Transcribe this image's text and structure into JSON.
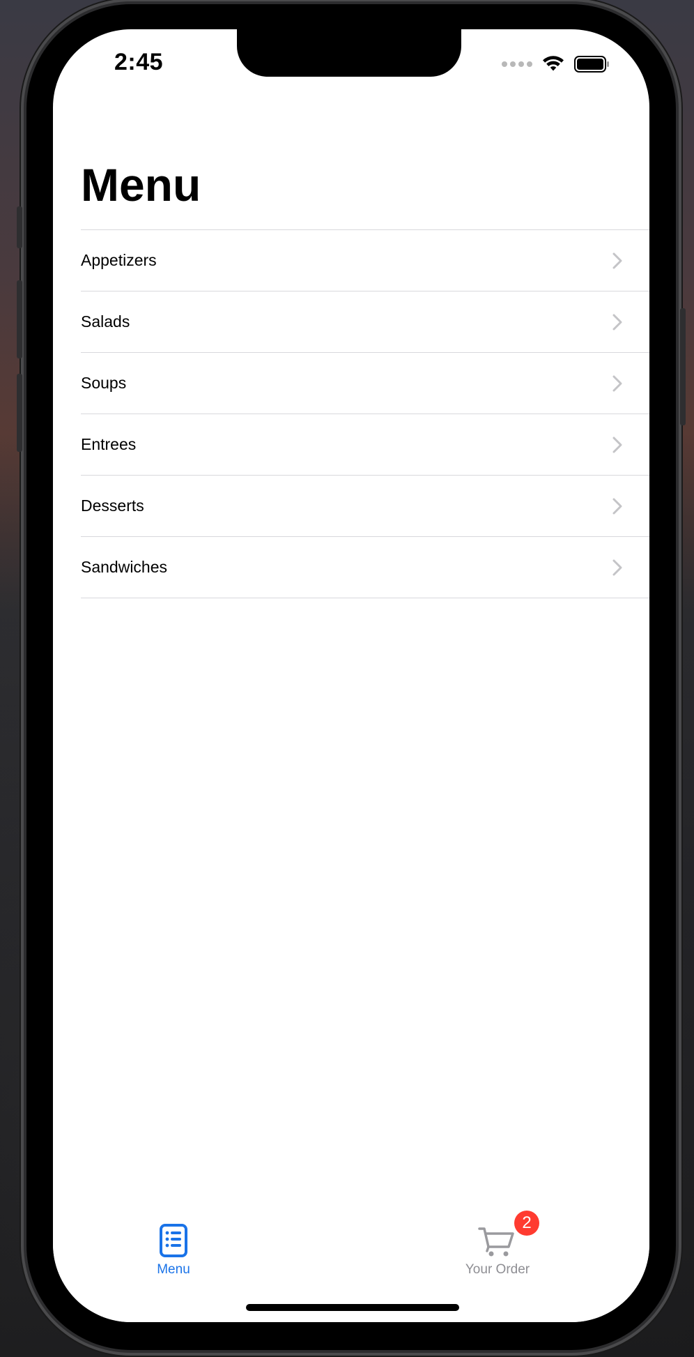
{
  "status_bar": {
    "time": "2:45"
  },
  "page": {
    "title": "Menu"
  },
  "menu": {
    "items": [
      {
        "label": "Appetizers"
      },
      {
        "label": "Salads"
      },
      {
        "label": "Soups"
      },
      {
        "label": "Entrees"
      },
      {
        "label": "Desserts"
      },
      {
        "label": "Sandwiches"
      }
    ]
  },
  "tab_bar": {
    "tabs": [
      {
        "label": "Menu",
        "icon": "menu-list-icon",
        "active": true
      },
      {
        "label": "Your Order",
        "icon": "cart-icon",
        "active": false,
        "badge": "2"
      }
    ]
  },
  "colors": {
    "accent": "#1a73e8",
    "badge": "#ff3b30",
    "inactive": "#8e8e93",
    "separator": "#d8d8dc"
  }
}
